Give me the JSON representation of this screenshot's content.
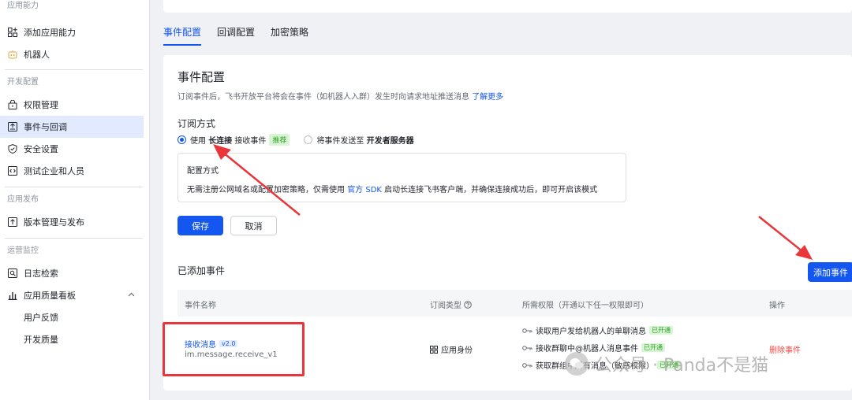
{
  "sidebar": {
    "groups": [
      {
        "label": "应用能力"
      },
      {
        "label": "开发配置"
      },
      {
        "label": "应用发布"
      },
      {
        "label": "运营监控"
      }
    ],
    "items": {
      "add_capability": "添加应用能力",
      "bot": "机器人",
      "permissions": "权限管理",
      "events": "事件与回调",
      "security": "安全设置",
      "test_company": "测试企业和人员",
      "versions": "版本管理与发布",
      "logs": "日志检索",
      "quality_board": "应用质量看板",
      "feedback": "用户反馈",
      "dev_quality": "开发质量"
    }
  },
  "tabs": [
    {
      "label": "事件配置"
    },
    {
      "label": "回调配置"
    },
    {
      "label": "加密策略"
    }
  ],
  "config": {
    "title": "事件配置",
    "desc": "订阅事件后，飞书开放平台将会在事件（如机器人入群）发生时向请求地址推送消息",
    "learn_more": "了解更多",
    "method_title": "订阅方式",
    "option1_prefix": "使用",
    "option1_bold": "长连接",
    "option1_suffix": "接收事件",
    "option1_badge": "推荐",
    "option2_prefix": "将事件发送至",
    "option2_bold": "开发者服务器",
    "box_title": "配置方式",
    "box_text_1": "无需注册公网域名或配置加密策略，仅需使用",
    "box_link": "官方 SDK",
    "box_text_2": "启动长连接飞书客户端，并确保连接成功后，即可开启该模式",
    "save": "保存",
    "cancel": "取消"
  },
  "events": {
    "title": "已添加事件",
    "add_button": "添加事件",
    "columns": {
      "name": "事件名称",
      "type": "订阅类型",
      "perms": "所需权限（开通以下任一权限即可）",
      "ops": "操作"
    },
    "rows": [
      {
        "name": "接收消息",
        "version": "v2.0",
        "id": "im.message.receive_v1",
        "type": "应用身份",
        "perms": [
          {
            "text": "读取用户发给机器人的单聊消息",
            "status": "已开通"
          },
          {
            "text": "接收群聊中@机器人消息事件",
            "status": "已开通"
          },
          {
            "text": "获取群组中所有消息（敏感权限）",
            "status": "已开通"
          }
        ],
        "action": "删除事件"
      }
    ]
  },
  "watermark": "公众号 · Panda不是猫",
  "colors": {
    "primary": "#1456f0",
    "danger": "#f54a45",
    "success": "#2ea121",
    "annotation": "#e8363a"
  }
}
